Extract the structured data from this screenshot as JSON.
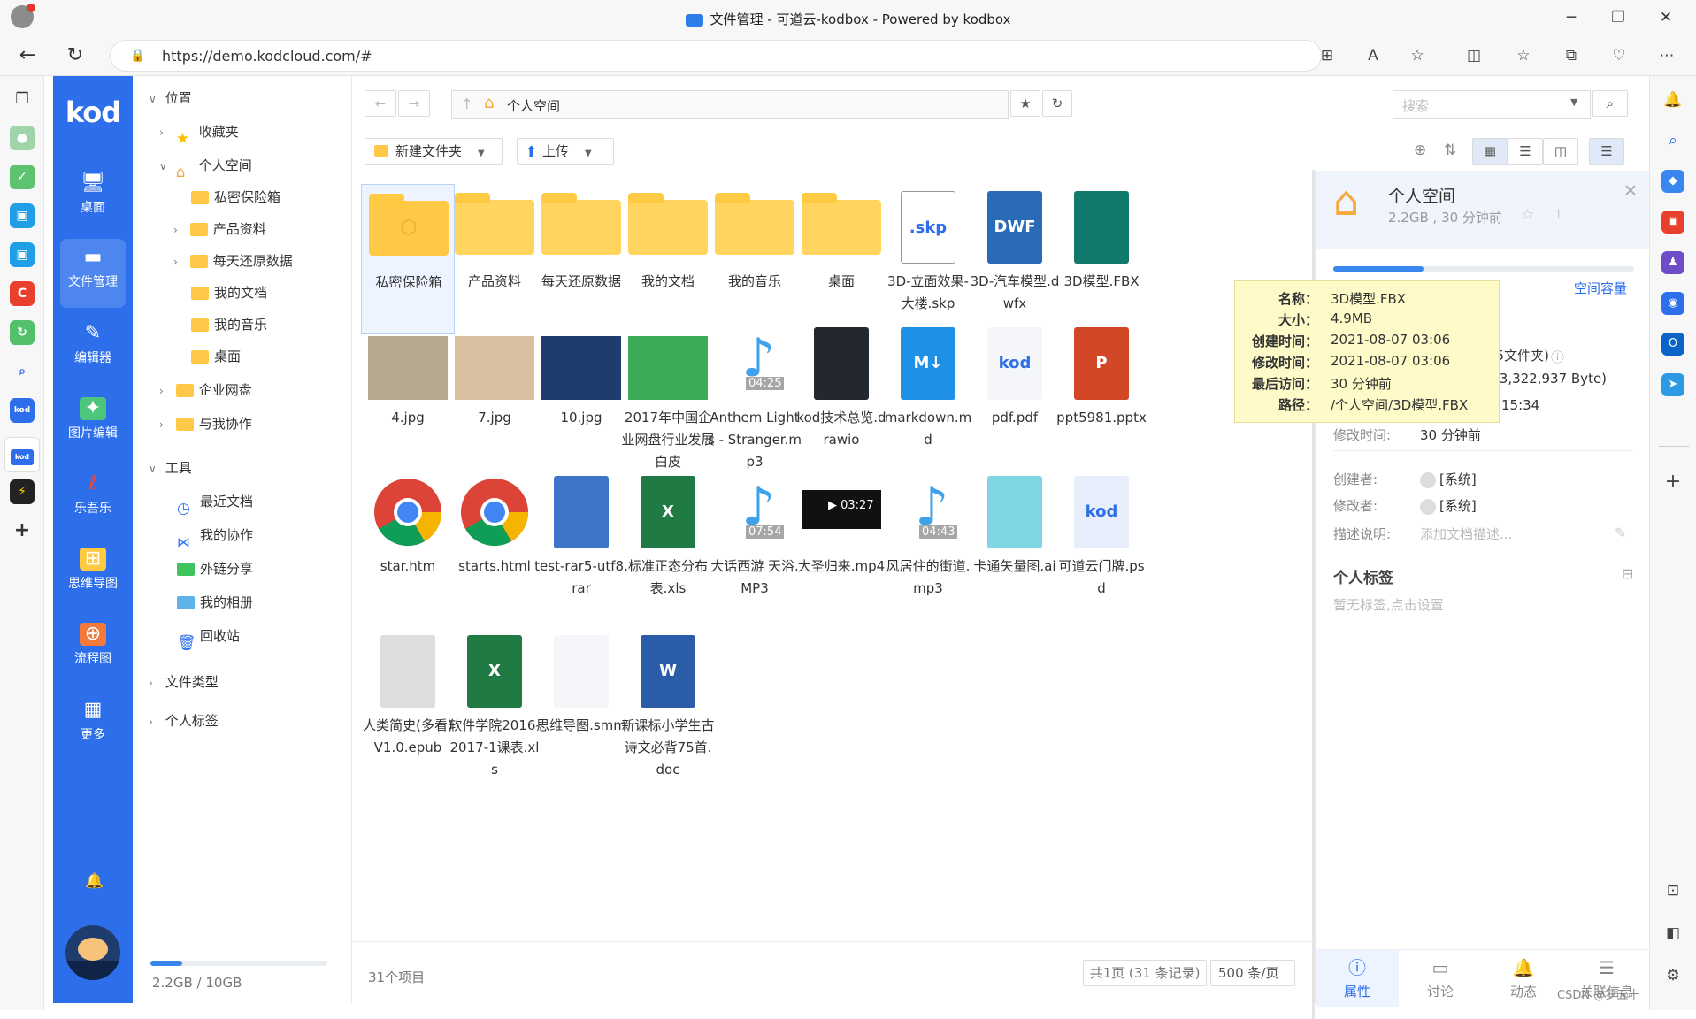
{
  "window": {
    "title": "文件管理 - 可道云-kodbox - Powered by kodbox"
  },
  "browser": {
    "url": "https://demo.kodcloud.com/#"
  },
  "app": {
    "logo": "kod",
    "nav": [
      {
        "label": "桌面",
        "icon": "desktop-icon"
      },
      {
        "label": "文件管理",
        "icon": "folder-icon"
      },
      {
        "label": "编辑器",
        "icon": "edit-icon"
      },
      {
        "label": "图片编辑",
        "icon": "image-edit-icon"
      },
      {
        "label": "乐吾乐",
        "icon": "brand-icon"
      },
      {
        "label": "思维导图",
        "icon": "mindmap-icon"
      },
      {
        "label": "流程图",
        "icon": "flowchart-icon"
      },
      {
        "label": "更多",
        "icon": "grid-icon"
      }
    ]
  },
  "tree": {
    "location": "位置",
    "favorites": "收藏夹",
    "personal": "个人空间",
    "children": [
      "私密保险箱",
      "产品资料",
      "每天还原数据",
      "我的文档",
      "我的音乐",
      "桌面"
    ],
    "enterprise": "企业网盘",
    "collab": "与我协作",
    "tools": "工具",
    "toolitems": [
      "最近文档",
      "我的协作",
      "外链分享",
      "我的相册",
      "回收站"
    ],
    "filetype": "文件类型",
    "tags": "个人标签",
    "quota": "2.2GB / 10GB",
    "quota_fraction": 0.18
  },
  "toolbar": {
    "newfolder": "新建文件夹",
    "upload": "上传",
    "crumb": "个人空间",
    "search_placeholder": "搜索"
  },
  "files": [
    {
      "name": "私密保险箱",
      "type": "folder"
    },
    {
      "name": "产品资料",
      "type": "folder"
    },
    {
      "name": "每天还原数据",
      "type": "folder"
    },
    {
      "name": "我的文档",
      "type": "folder"
    },
    {
      "name": "我的音乐",
      "type": "folder"
    },
    {
      "name": "桌面",
      "type": "folder"
    },
    {
      "name": "3D-立面效果-大楼.skp",
      "type": "skp",
      "badge": ".skp"
    },
    {
      "name": "3D-汽车模型.dwfx",
      "type": "dwf",
      "badge": "DWF"
    },
    {
      "name": "3D模型.FBX",
      "type": "fbx"
    },
    {
      "name": "4.jpg",
      "type": "photo"
    },
    {
      "name": "7.jpg",
      "type": "photo"
    },
    {
      "name": "10.jpg",
      "type": "photo"
    },
    {
      "name": "2017年中国企业网盘行业发展白皮",
      "type": "photo"
    },
    {
      "name": "Anthem Lights - Stranger.mp3",
      "type": "audio",
      "dur": "04:25"
    },
    {
      "name": "kod技术总览.drawio",
      "type": "drawio"
    },
    {
      "name": "markdown.md",
      "type": "md",
      "badge": "M↓"
    },
    {
      "name": "pdf.pdf",
      "type": "pdf",
      "badge": "kod"
    },
    {
      "name": "ppt5981.pptx",
      "type": "ppt",
      "badge": "P"
    },
    {
      "name": "star.htm",
      "type": "chrome"
    },
    {
      "name": "starts.html",
      "type": "chrome"
    },
    {
      "name": "test-rar5-utf8.rar",
      "type": "rar"
    },
    {
      "name": "标准正态分布表.xls",
      "type": "xls",
      "badge": "X"
    },
    {
      "name": "大话西游 天浴.MP3",
      "type": "audio",
      "dur": "07:54"
    },
    {
      "name": "大圣归来.mp4",
      "type": "video",
      "dur": "03:27"
    },
    {
      "name": "风居住的街道.mp3",
      "type": "audio",
      "dur": "04:43"
    },
    {
      "name": "卡通矢量图.ai",
      "type": "ai"
    },
    {
      "name": "可道云门牌.psd",
      "type": "psd",
      "badge": "kod"
    },
    {
      "name": "人类简史(多看)V1.0.epub",
      "type": "epub"
    },
    {
      "name": "软件学院2016-2017-1课表.xls",
      "type": "xls",
      "badge": "X"
    },
    {
      "name": "思维导图.smm",
      "type": "smm"
    },
    {
      "name": "新课标小学生古诗文必背75首.doc",
      "type": "doc",
      "badge": "W"
    }
  ],
  "footer": {
    "count": "31个项目",
    "pages": "共1页 (31 条记录)",
    "perpage": "500 条/页"
  },
  "info": {
    "title": "个人空间",
    "sub": "2.2GB , 30 分钟前",
    "capacity": "空间容量",
    "capacity_fraction": 0.3,
    "rows": [
      {
        "k": "",
        "v": "(2523个, 5文件夹)"
      },
      {
        "k": "",
        "v": "2.2GB (2,383,322,937 Byte)"
      },
      {
        "k": "",
        "v": "15:34"
      },
      {
        "k": "修改时间:",
        "v": "30 分钟前"
      },
      {
        "k": "创建者:",
        "v": "[系统]"
      },
      {
        "k": "修改者:",
        "v": "[系统]"
      },
      {
        "k": "描述说明:",
        "v": "添加文档描述..."
      }
    ],
    "tagtitle": "个人标签",
    "tagempty": "暂无标签,点击设置",
    "tabs": [
      "属性",
      "讨论",
      "动态",
      "关联信息"
    ]
  },
  "tooltip": {
    "rows": [
      {
        "k": "名称：",
        "v": "3D模型.FBX"
      },
      {
        "k": "大小：",
        "v": "4.9MB"
      },
      {
        "k": "创建时间：",
        "v": "2021-08-07 03:06"
      },
      {
        "k": "修改时间：",
        "v": "2021-08-07 03:06"
      },
      {
        "k": "最后访问：",
        "v": "30 分钟前"
      },
      {
        "k": "路径：",
        "v": "/个人空间/3D模型.FBX"
      }
    ]
  },
  "watermark": "CSDN @罗五十"
}
